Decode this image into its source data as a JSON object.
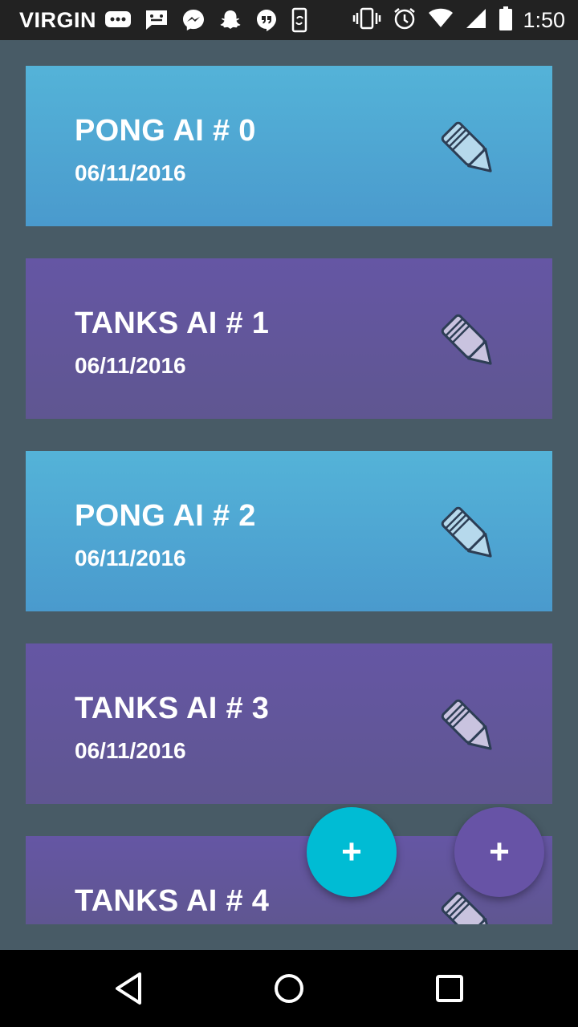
{
  "status_bar": {
    "carrier": "VIRGIN",
    "time": "1:50",
    "notification_icons": [
      "messages-icon",
      "sms-icon",
      "messenger-icon",
      "snapchat-icon",
      "hangouts-icon",
      "phone-sync-icon"
    ],
    "system_icons": [
      "vibrate-icon",
      "alarm-icon",
      "wifi-icon",
      "signal-icon",
      "battery-icon"
    ]
  },
  "cards": [
    {
      "title": "PONG AI # 0",
      "date": "06/11/2016",
      "type": "pong"
    },
    {
      "title": "TANKS AI # 1",
      "date": "06/11/2016",
      "type": "tanks"
    },
    {
      "title": "PONG AI # 2",
      "date": "06/11/2016",
      "type": "pong"
    },
    {
      "title": "TANKS AI # 3",
      "date": "06/11/2016",
      "type": "tanks"
    },
    {
      "title": "TANKS AI # 4",
      "date": "",
      "type": "tanks"
    }
  ],
  "fabs": {
    "cyan_label": "+",
    "purple_label": "+"
  },
  "colors": {
    "background": "#485b66",
    "pong_card": "#4fa8d4",
    "tanks_card": "#6255a0",
    "fab_cyan": "#00bcd4",
    "fab_purple": "#6753a6"
  },
  "navigation": [
    "back-icon",
    "home-icon",
    "recent-apps-icon"
  ]
}
